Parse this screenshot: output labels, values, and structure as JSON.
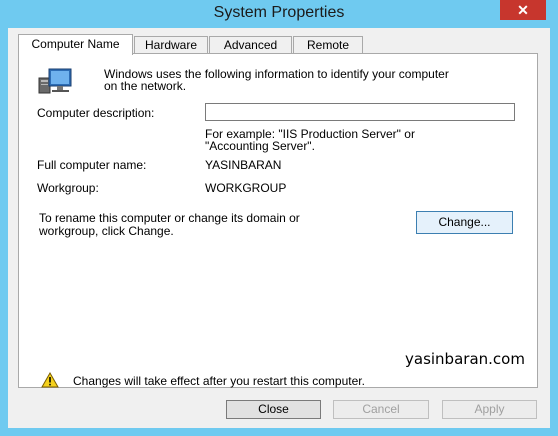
{
  "window": {
    "title": "System Properties",
    "close_glyph": "✕",
    "accent": "#6fcaf0",
    "close_color": "#c7362d"
  },
  "tabs": [
    {
      "label": "Computer Name",
      "active": true
    },
    {
      "label": "Hardware",
      "active": false
    },
    {
      "label": "Advanced",
      "active": false
    },
    {
      "label": "Remote",
      "active": false
    }
  ],
  "panel": {
    "intro_line1": "Windows uses the following information to identify your computer",
    "intro_line2": "on the network.",
    "description_label": "Computer description:",
    "description_value": "",
    "example_line1": "For example: \"IIS Production Server\" or",
    "example_line2": "\"Accounting Server\".",
    "full_name_label": "Full computer name:",
    "full_name_value": "YASINBARAN",
    "workgroup_label": "Workgroup:",
    "workgroup_value": "WORKGROUP",
    "rename_line1": "To rename this computer or change its domain or",
    "rename_line2": "workgroup, click Change.",
    "change_button": "Change...",
    "watermark": "yasinbaran.com",
    "warning_text": "Changes will take effect after you restart this computer.",
    "icons": [
      "computer-icon",
      "warning-icon"
    ]
  },
  "footer": {
    "close_button": "Close",
    "cancel_button": "Cancel",
    "apply_button": "Apply"
  }
}
